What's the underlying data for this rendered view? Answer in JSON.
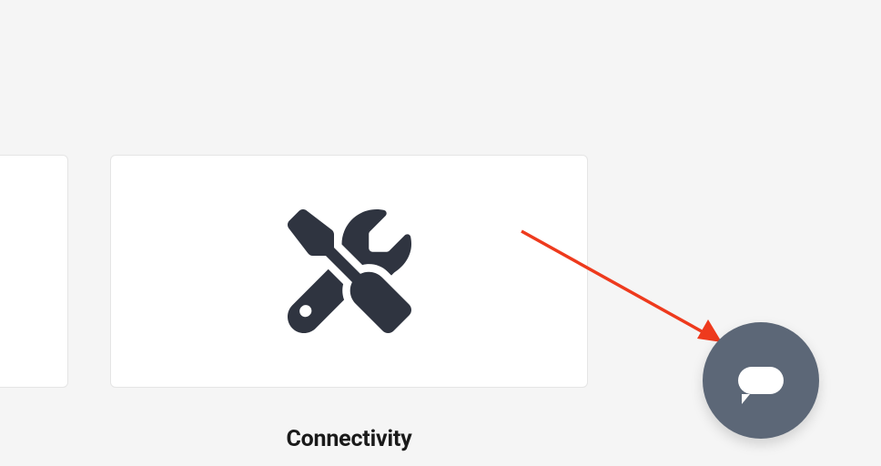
{
  "cards": {
    "partial": {
      "icon": "unknown"
    },
    "main": {
      "icon": "tools-icon",
      "label": "Connectivity"
    }
  },
  "chat": {
    "aria": "Open chat"
  },
  "annotation": {
    "type": "arrow",
    "color": "#ee3a1d"
  }
}
